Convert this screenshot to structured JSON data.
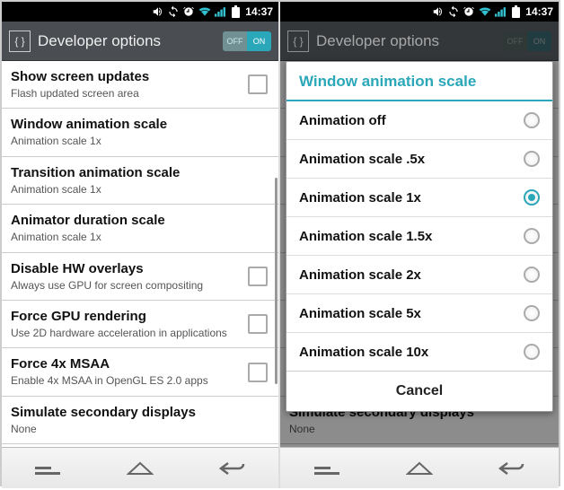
{
  "status": {
    "time": "14:37"
  },
  "appbar": {
    "title": "Developer options",
    "toggle_off": "OFF",
    "toggle_on": "ON"
  },
  "settings": [
    {
      "title": "Show screen updates",
      "sub": "Flash updated screen area",
      "checkbox": true
    },
    {
      "title": "Window animation scale",
      "sub": "Animation scale 1x",
      "checkbox": false
    },
    {
      "title": "Transition animation scale",
      "sub": "Animation scale 1x",
      "checkbox": false
    },
    {
      "title": "Animator duration scale",
      "sub": "Animation scale 1x",
      "checkbox": false
    },
    {
      "title": "Disable HW overlays",
      "sub": "Always use GPU for screen compositing",
      "checkbox": true
    },
    {
      "title": "Force GPU rendering",
      "sub": "Use 2D hardware acceleration in applications",
      "checkbox": true
    },
    {
      "title": "Force 4x MSAA",
      "sub": "Enable 4x MSAA in OpenGL ES 2.0 apps",
      "checkbox": true
    },
    {
      "title": "Simulate secondary displays",
      "sub": "None",
      "checkbox": false
    }
  ],
  "dialog": {
    "title": "Window animation scale",
    "options": [
      {
        "label": "Animation off",
        "selected": false
      },
      {
        "label": "Animation scale .5x",
        "selected": false
      },
      {
        "label": "Animation scale 1x",
        "selected": true
      },
      {
        "label": "Animation scale 1.5x",
        "selected": false
      },
      {
        "label": "Animation scale 2x",
        "selected": false
      },
      {
        "label": "Animation scale 5x",
        "selected": false
      },
      {
        "label": "Animation scale 10x",
        "selected": false
      }
    ],
    "cancel": "Cancel"
  }
}
